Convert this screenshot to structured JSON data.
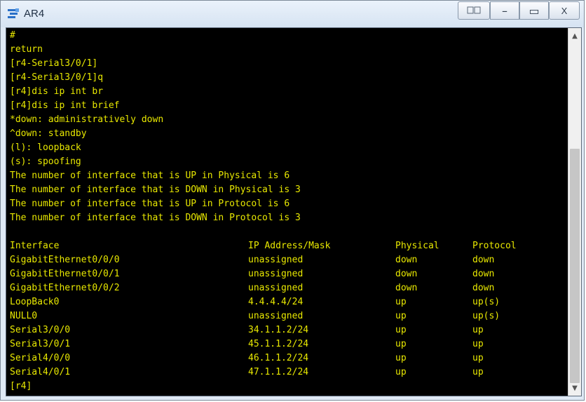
{
  "window": {
    "title": "AR4",
    "controls": {
      "extra": "",
      "minimize": "–",
      "maximize": "▭",
      "close": "X"
    }
  },
  "terminal": {
    "lines": [
      "#",
      "return",
      "[r4-Serial3/0/1]",
      "[r4-Serial3/0/1]q",
      "[r4]dis ip int br",
      "[r4]dis ip int brief",
      "*down: administratively down",
      "^down: standby",
      "(l): loopback",
      "(s): spoofing",
      "The number of interface that is UP in Physical is 6",
      "The number of interface that is DOWN in Physical is 3",
      "The number of interface that is UP in Protocol is 6",
      "The number of interface that is DOWN in Protocol is 3",
      ""
    ],
    "table": {
      "headers": [
        "Interface",
        "IP Address/Mask",
        "Physical",
        "Protocol"
      ],
      "rows": [
        [
          "GigabitEthernet0/0/0",
          "unassigned",
          "down",
          "down"
        ],
        [
          "GigabitEthernet0/0/1",
          "unassigned",
          "down",
          "down"
        ],
        [
          "GigabitEthernet0/0/2",
          "unassigned",
          "down",
          "down"
        ],
        [
          "LoopBack0",
          "4.4.4.4/24",
          "up",
          "up(s)"
        ],
        [
          "NULL0",
          "unassigned",
          "up",
          "up(s)"
        ],
        [
          "Serial3/0/0",
          "34.1.1.2/24",
          "up",
          "up"
        ],
        [
          "Serial3/0/1",
          "45.1.1.2/24",
          "up",
          "up"
        ],
        [
          "Serial4/0/0",
          "46.1.1.2/24",
          "up",
          "up"
        ],
        [
          "Serial4/0/1",
          "47.1.1.2/24",
          "up",
          "up"
        ]
      ]
    },
    "prompt": "[r4]",
    "text_color": "#e8e800",
    "background_color": "#000000"
  },
  "scrollbar": {
    "up_icon": "chevron-up-icon",
    "down_icon": "chevron-down-icon"
  }
}
